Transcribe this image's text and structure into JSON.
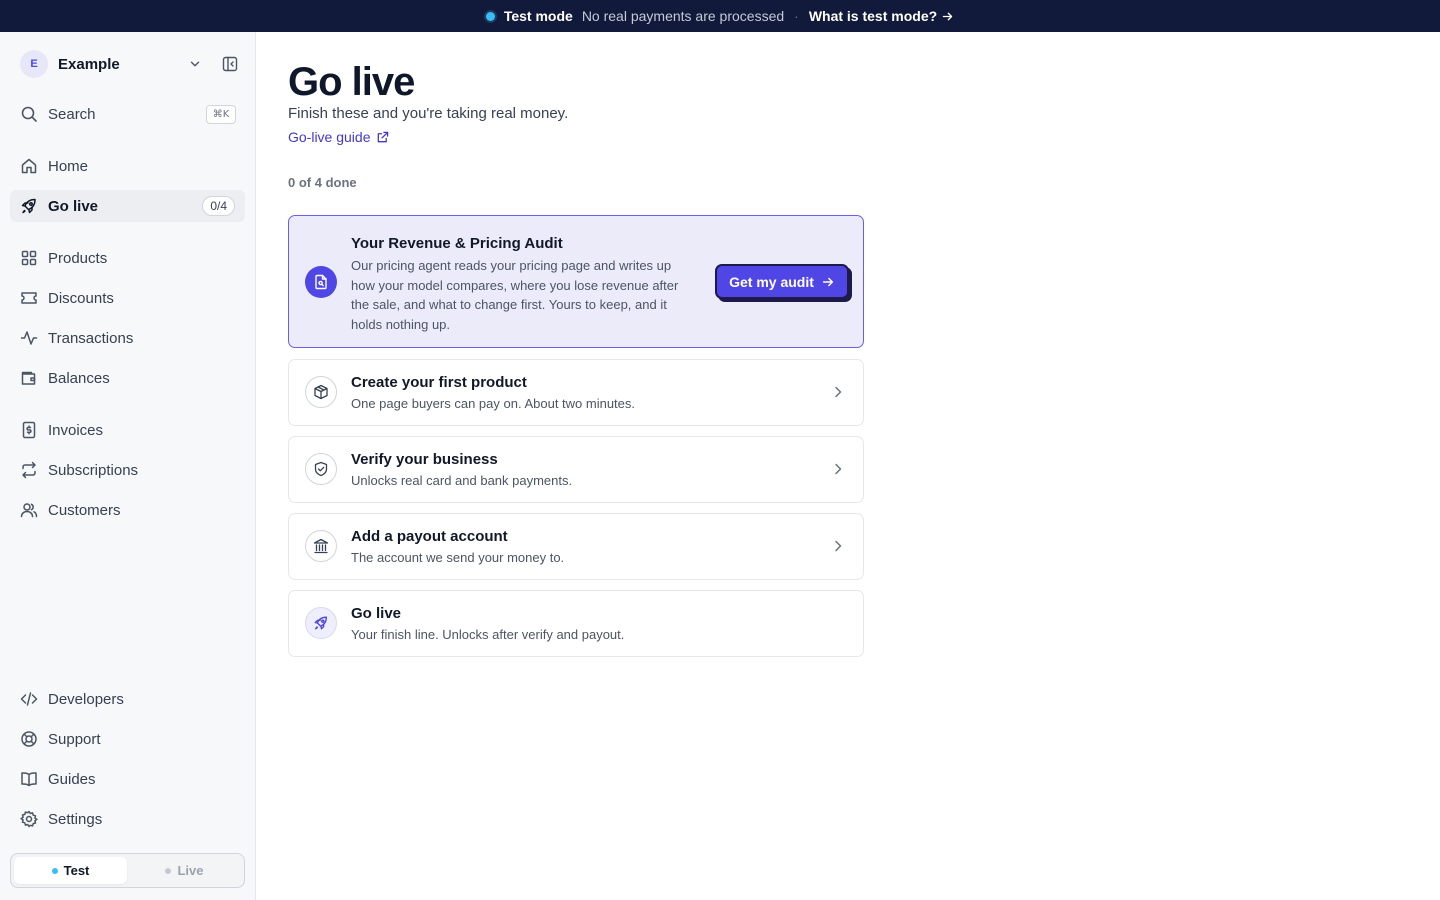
{
  "banner": {
    "mode": "Test mode",
    "message": "No real payments are processed",
    "separator": "·",
    "link": "What is test mode?"
  },
  "sidebar": {
    "workspace": {
      "initial": "E",
      "name": "Example"
    },
    "search": {
      "label": "Search",
      "shortcut": "⌘K"
    },
    "items": [
      {
        "label": "Home",
        "icon": "home-icon"
      },
      {
        "label": "Go live",
        "icon": "rocket-icon",
        "count": "0/4",
        "active": true
      },
      {
        "label": "Products",
        "icon": "grid-icon"
      },
      {
        "label": "Discounts",
        "icon": "ticket-icon"
      },
      {
        "label": "Transactions",
        "icon": "activity-icon"
      },
      {
        "label": "Balances",
        "icon": "wallet-icon"
      },
      {
        "label": "Invoices",
        "icon": "invoice-icon"
      },
      {
        "label": "Subscriptions",
        "icon": "repeat-icon"
      },
      {
        "label": "Customers",
        "icon": "users-icon"
      }
    ],
    "footer_items": [
      {
        "label": "Developers",
        "icon": "code-icon"
      },
      {
        "label": "Support",
        "icon": "lifebuoy-icon"
      },
      {
        "label": "Guides",
        "icon": "book-icon"
      },
      {
        "label": "Settings",
        "icon": "gear-icon"
      }
    ],
    "env_toggle": {
      "test": "Test",
      "live": "Live"
    }
  },
  "main": {
    "title": "Go live",
    "subtitle": "Finish these and you're taking real money.",
    "guide_link": "Go-live guide",
    "progress": "0 of 4 done",
    "audit": {
      "title": "Your Revenue & Pricing Audit",
      "description": "Our pricing agent reads your pricing page and writes up how your model compares, where you lose revenue after the sale, and what to change first. Yours to keep, and it holds nothing up.",
      "button": "Get my audit"
    },
    "steps": [
      {
        "title": "Create your first product",
        "description": "One page buyers can pay on. About two minutes.",
        "icon": "box-icon"
      },
      {
        "title": "Verify your business",
        "description": "Unlocks real card and bank payments.",
        "icon": "shield-icon"
      },
      {
        "title": "Add a payout account",
        "description": "The account we send your money to.",
        "icon": "bank-icon"
      },
      {
        "title": "Go live",
        "description": "Your finish line. Unlocks after verify and payout.",
        "icon": "rocket-icon"
      }
    ]
  },
  "colors": {
    "accent": "#4f46e5",
    "banner_bg": "#111a3a",
    "test_dot": "#38bdf8",
    "audit_bg": "#ecebfa"
  }
}
